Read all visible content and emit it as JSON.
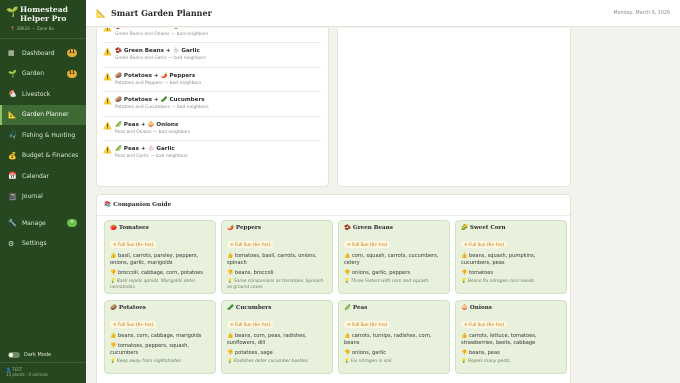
{
  "app": {
    "name_line1": "Homestead",
    "name_line2": "Helper Pro",
    "location": "38634 — Zone 8a"
  },
  "sidebar": {
    "items": [
      {
        "label": "Dashboard",
        "icon": "grid-icon",
        "glyph": "▦",
        "badge": "11"
      },
      {
        "label": "Garden",
        "icon": "sprout-icon",
        "glyph": "🌱",
        "badge": "11"
      },
      {
        "label": "Livestock",
        "icon": "chicken-icon",
        "glyph": "🐔",
        "badge": ""
      },
      {
        "label": "Garden Planner",
        "icon": "ruler-icon",
        "glyph": "📐",
        "badge": ""
      },
      {
        "label": "Fishing & Hunting",
        "icon": "fishing-icon",
        "glyph": "🎣",
        "badge": ""
      },
      {
        "label": "Budget & Finances",
        "icon": "money-icon",
        "glyph": "💰",
        "badge": ""
      },
      {
        "label": "Calendar",
        "icon": "calendar-icon",
        "glyph": "📅",
        "badge": ""
      },
      {
        "label": "Journal",
        "icon": "journal-icon",
        "glyph": "📓",
        "badge": ""
      },
      {
        "label": "Manage",
        "icon": "wrench-icon",
        "glyph": "🔧",
        "badge": "+"
      },
      {
        "label": "Settings",
        "icon": "gear-icon",
        "glyph": "⚙",
        "badge": ""
      }
    ],
    "dark_mode_label": "Dark Mode",
    "footer_line1": "TEST",
    "footer_line2": "15 plants · 0 animals"
  },
  "header": {
    "title": "Smart Garden Planner",
    "date": "Monday, March 9, 2026"
  },
  "conflicts": [
    {
      "pair": "🫘 Green Beans + 🧅 Onions",
      "reason": "Green Beans and Onions — bad neighbors"
    },
    {
      "pair": "🫘 Green Beans + 🧄 Garlic",
      "reason": "Green Beans and Garlic — bad neighbors"
    },
    {
      "pair": "🥔 Potatoes + 🌶️ Peppers",
      "reason": "Potatoes and Peppers — bad neighbors"
    },
    {
      "pair": "🥔 Potatoes + 🥒 Cucumbers",
      "reason": "Potatoes and Cucumbers — bad neighbors"
    },
    {
      "pair": "🫛 Peas + 🧅 Onions",
      "reason": "Peas and Onions — bad neighbors"
    },
    {
      "pair": "🫛 Peas + 🧄 Garlic",
      "reason": "Peas and Garlic — bad neighbors"
    }
  ],
  "guide": {
    "title": "📚 Companion Guide",
    "sun_label": "☀ Full Sun (6+ hrs)",
    "cards": [
      {
        "name": "🍅 Tomatoes",
        "good": "basil, carrots, parsley, peppers, onions, garlic, marigolds",
        "bad": "broccoli, cabbage, corn, potatoes",
        "tip": "Basil repels aphids. Marigolds deter nematodes."
      },
      {
        "name": "🌶️ Peppers",
        "good": "tomatoes, basil, carrots, onions, spinach",
        "bad": "beans, broccoli",
        "tip": "Same companions as tomatoes. Spinach as ground cover."
      },
      {
        "name": "🫘 Green Beans",
        "good": "corn, squash, carrots, cucumbers, celery",
        "bad": "onions, garlic, peppers",
        "tip": "Three Sisters with corn and squash."
      },
      {
        "name": "🌽 Sweet Corn",
        "good": "beans, squash, pumpkins, cucumbers, peas",
        "bad": "tomatoes",
        "tip": "Beans fix nitrogen corn needs."
      },
      {
        "name": "🥔 Potatoes",
        "good": "beans, corn, cabbage, marigolds",
        "bad": "tomatoes, peppers, squash, cucumbers",
        "tip": "Keep away from nightshades."
      },
      {
        "name": "🥒 Cucumbers",
        "good": "beans, corn, peas, radishes, sunflowers, dill",
        "bad": "potatoes, sage",
        "tip": "Radishes deter cucumber beetles."
      },
      {
        "name": "🫛 Peas",
        "good": "carrots, turnips, radishes, corn, beans",
        "bad": "onions, garlic",
        "tip": "Fix nitrogen in soil."
      },
      {
        "name": "🧅 Onions",
        "good": "carrots, lettuce, tomatoes, strawberries, beets, cabbage",
        "bad": "beans, peas",
        "tip": "Repels many pests."
      }
    ]
  }
}
